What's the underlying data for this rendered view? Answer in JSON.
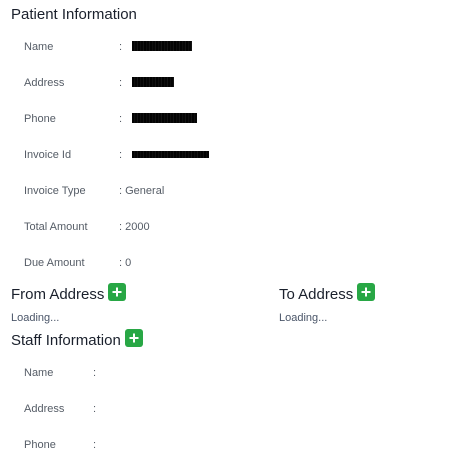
{
  "patient": {
    "title": "Patient Information",
    "fields": [
      {
        "label": "Name",
        "value": ""
      },
      {
        "label": "Address",
        "value": ""
      },
      {
        "label": "Phone",
        "value": ""
      },
      {
        "label": "Invoice Id",
        "value": ""
      },
      {
        "label": "Invoice Type",
        "value": "General"
      },
      {
        "label": "Total Amount",
        "value": "2000"
      },
      {
        "label": "Due Amount",
        "value": "0"
      }
    ],
    "separator": ":"
  },
  "from_address": {
    "title": "From Address",
    "status": "Loading...",
    "add_icon": "plus-icon"
  },
  "to_address": {
    "title": "To Address",
    "status": "Loading...",
    "add_icon": "plus-icon"
  },
  "staff": {
    "title": "Staff Information",
    "add_icon": "plus-icon",
    "fields": [
      {
        "label": "Name",
        "value": ""
      },
      {
        "label": "Address",
        "value": ""
      },
      {
        "label": "Phone",
        "value": ""
      }
    ],
    "separator": ":"
  },
  "colors": {
    "add_button": "#28a745",
    "title_text": "#1a202c",
    "label_text": "#555c66"
  }
}
